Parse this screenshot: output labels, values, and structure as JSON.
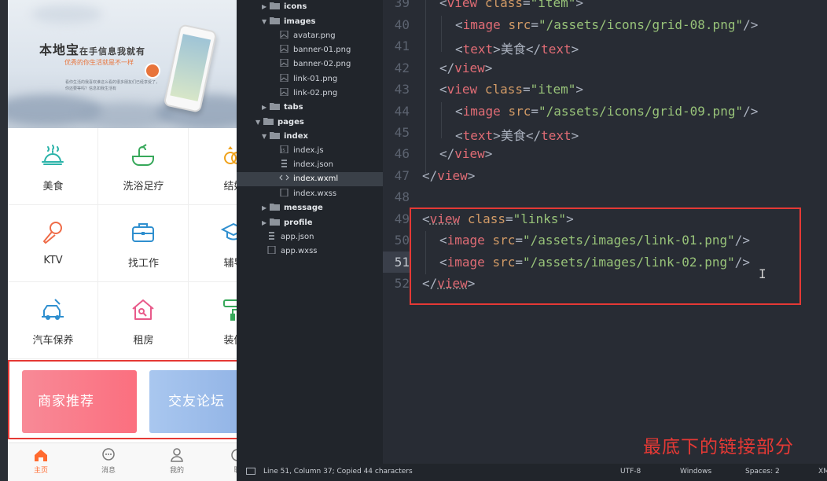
{
  "phone": {
    "banner": {
      "title": "本地宝",
      "title_suffix": "在手信息我就有",
      "subtitle": "优秀的你生活就是不一样",
      "note": "看你生活的我喜欢谁这么看的很多朋友们已经享受了，你还要等吗？信息如我生活有"
    },
    "grid": [
      {
        "label": "美食",
        "icon": "food-cloche-icon"
      },
      {
        "label": "洗浴足疗",
        "icon": "bath-tub-icon"
      },
      {
        "label": "结婚",
        "icon": "wedding-rings-icon"
      },
      {
        "label": "KTV",
        "icon": "microphone-icon"
      },
      {
        "label": "找工作",
        "icon": "briefcase-icon"
      },
      {
        "label": "辅导",
        "icon": "graduation-cap-icon"
      },
      {
        "label": "汽车保养",
        "icon": "car-service-icon"
      },
      {
        "label": "租房",
        "icon": "house-key-icon"
      },
      {
        "label": "装修",
        "icon": "paint-roller-icon"
      }
    ],
    "links": [
      {
        "label": "商家推荐"
      },
      {
        "label": "交友论坛"
      }
    ],
    "tabs": [
      {
        "label": "主页",
        "icon": "home-icon",
        "active": true
      },
      {
        "label": "消息",
        "icon": "chat-bubble-icon",
        "active": false
      },
      {
        "label": "我的",
        "icon": "user-icon",
        "active": false
      },
      {
        "label": "联",
        "icon": "contact-icon",
        "active": false
      }
    ],
    "accent_color": "#ff6a2f"
  },
  "tree": {
    "rows": [
      {
        "label": "icons",
        "type": "folder",
        "expanded": false
      },
      {
        "label": "images",
        "type": "folder",
        "expanded": true
      },
      {
        "label": "avatar.png",
        "type": "image"
      },
      {
        "label": "banner-01.png",
        "type": "image"
      },
      {
        "label": "banner-02.png",
        "type": "image"
      },
      {
        "label": "link-01.png",
        "type": "image"
      },
      {
        "label": "link-02.png",
        "type": "image"
      },
      {
        "label": "tabs",
        "type": "folder",
        "expanded": false
      },
      {
        "label": "pages",
        "type": "folder",
        "expanded": true
      },
      {
        "label": "index",
        "type": "folder",
        "expanded": true
      },
      {
        "label": "index.js",
        "type": "js"
      },
      {
        "label": "index.json",
        "type": "json"
      },
      {
        "label": "index.wxml",
        "type": "xml",
        "selected": true
      },
      {
        "label": "index.wxss",
        "type": "file"
      },
      {
        "label": "message",
        "type": "folder",
        "expanded": false
      },
      {
        "label": "profile",
        "type": "folder",
        "expanded": false
      },
      {
        "label": "app.json",
        "type": "json"
      },
      {
        "label": "app.wxss",
        "type": "file"
      }
    ]
  },
  "editor": {
    "line_numbers": [
      "39",
      "40",
      "41",
      "42",
      "43",
      "44",
      "45",
      "46",
      "47",
      "48",
      "49",
      "50",
      "51",
      "52"
    ],
    "current_line": "51",
    "tokens": {
      "lt": "<",
      "lt_slash": "</",
      "gt": ">",
      "self_close": "/>",
      "eq": "=",
      "view": "view",
      "image": "image",
      "text": "text",
      "class": "class",
      "src": "src",
      "item_val": "\"item\"",
      "links_val": "\"links\"",
      "grid08": "\"/assets/icons/grid-08.png\"",
      "grid09": "\"/assets/icons/grid-09.png\"",
      "link01": "\"/assets/images/link-01.png\"",
      "link02": "\"/assets/images/link-02.png\"",
      "food": "美食"
    },
    "annotation": "最底下的链接部分",
    "ibeam": "I"
  },
  "status": {
    "position": "Line 51, Column 37; Copied 44 characters",
    "encoding": "UTF-8",
    "line_endings": "Windows",
    "indent": "Spaces: 2",
    "syntax": "XM"
  },
  "colors": {
    "highlight_box": "#e53935",
    "tag": "#e06c75",
    "attr": "#d19a66",
    "string": "#98c379"
  }
}
